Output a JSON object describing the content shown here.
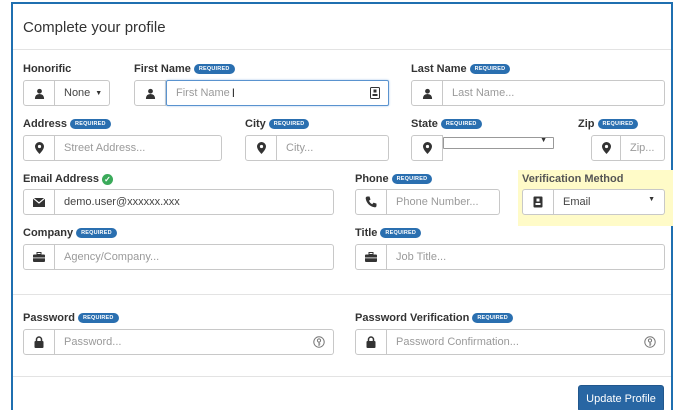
{
  "title": "Complete your profile",
  "required_badge": "REQUIRED",
  "labels": {
    "honorific": "Honorific",
    "first_name": "First Name",
    "last_name": "Last Name",
    "address": "Address",
    "city": "City",
    "state": "State",
    "zip": "Zip",
    "email": "Email Address",
    "phone": "Phone",
    "verification": "Verification Method",
    "company": "Company",
    "job_title": "Title",
    "password": "Password",
    "password_verification": "Password Verification"
  },
  "fields": {
    "honorific_value": "None",
    "first_name_placeholder": "First Name",
    "last_name_placeholder": "Last Name...",
    "address_placeholder": "Street Address...",
    "city_placeholder": "City...",
    "state_value": "",
    "zip_placeholder": "Zip...",
    "email_value": "demo.user@xxxxxx.xxx",
    "phone_placeholder": "Phone Number...",
    "verification_value": "Email",
    "company_placeholder": "Agency/Company...",
    "job_title_placeholder": "Job Title...",
    "password_placeholder": "Password...",
    "password_confirm_placeholder": "Password Confirmation..."
  },
  "buttons": {
    "update_profile": "Update Profile"
  },
  "colors": {
    "accent": "#2866a3",
    "badge": "#2a6fb0",
    "highlight": "#fffbc8",
    "success": "#3aaa5a"
  }
}
